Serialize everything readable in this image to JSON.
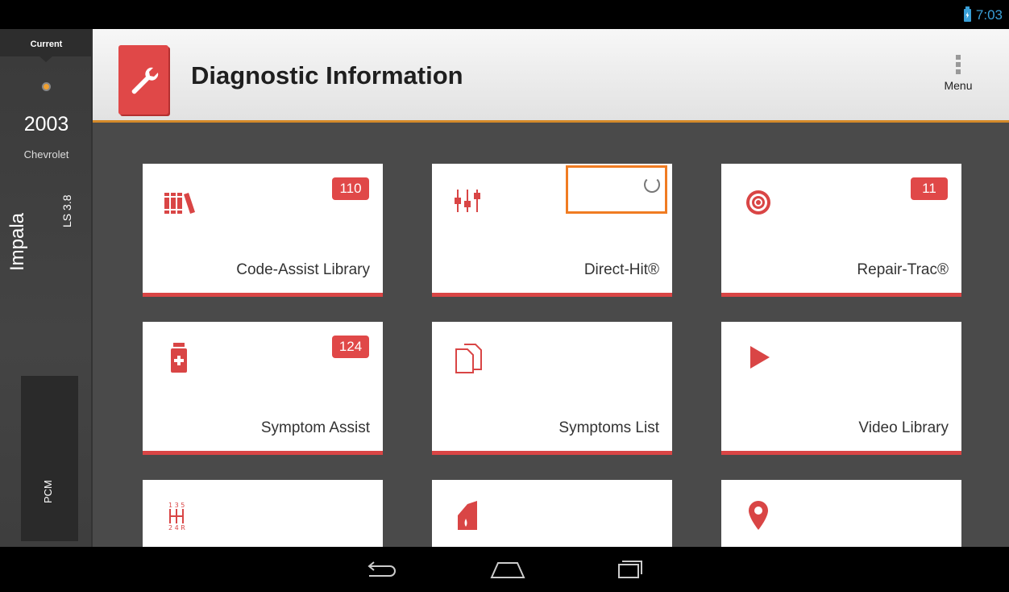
{
  "status_bar": {
    "time": "7:03",
    "battery_color": "#3aa0d8"
  },
  "sidebar": {
    "current_label": "Current",
    "year": "2003",
    "make": "Chevrolet",
    "model": "Impala",
    "engine": "LS 3.8",
    "module": "PCM"
  },
  "header": {
    "title": "Diagnostic Information",
    "menu_label": "Menu",
    "icon": "wrench-book-icon",
    "accent_color": "#d48a2a"
  },
  "tiles": [
    {
      "label": "Code-Assist Library",
      "badge": "110",
      "icon": "books-icon"
    },
    {
      "label": "Direct-Hit®",
      "badge": "",
      "icon": "sliders-icon",
      "loading": true
    },
    {
      "label": "Repair-Trac®",
      "badge": "11",
      "icon": "target-icon"
    },
    {
      "label": "Symptom Assist",
      "badge": "124",
      "icon": "medicine-bottle-icon"
    },
    {
      "label": "Symptoms List",
      "badge": "",
      "icon": "documents-icon"
    },
    {
      "label": "Video Library",
      "badge": "",
      "icon": "play-icon"
    },
    {
      "label": "",
      "badge": "",
      "icon": "gear-shift-icon"
    },
    {
      "label": "",
      "badge": "",
      "icon": "oil-can-icon"
    },
    {
      "label": "",
      "badge": "",
      "icon": "map-pin-icon"
    }
  ],
  "theme": {
    "tile_accent": "#d94545",
    "badge_color": "#e04848",
    "highlight": "#f07c22"
  },
  "nav": {
    "back": "back-icon",
    "home": "home-icon",
    "recents": "recents-icon"
  }
}
